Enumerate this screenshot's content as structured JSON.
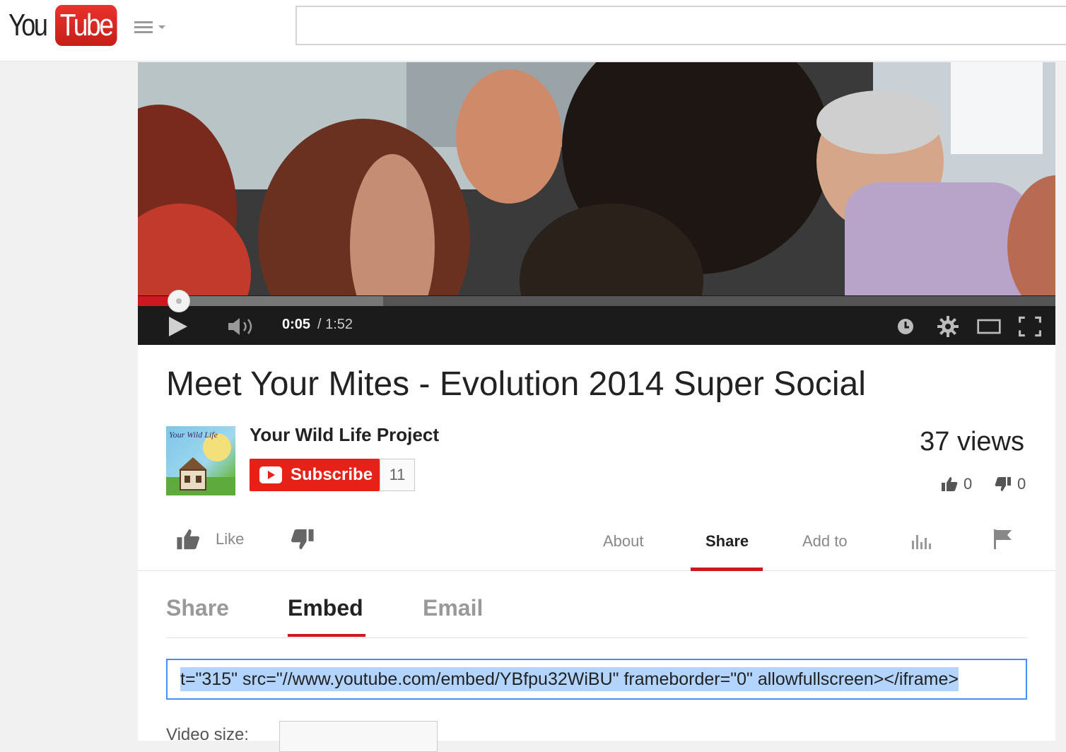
{
  "header": {
    "logo_you": "You",
    "logo_tube": "Tube",
    "search_placeholder": ""
  },
  "player": {
    "current_time": "0:05",
    "separator": " / ",
    "duration": "1:52",
    "progress_played_fraction": 0.045,
    "progress_loaded_fraction": 0.267
  },
  "video": {
    "title": "Meet Your Mites - Evolution 2014 Super Social",
    "channel_name": "Your Wild Life Project",
    "subscribe_label": "Subscribe",
    "subscriber_count": "11",
    "views": "37 views",
    "likes": "0",
    "dislikes": "0",
    "avatar_text": "Your Wild Life"
  },
  "actions": {
    "like_label": "Like",
    "tabs": [
      {
        "label": "About"
      },
      {
        "label": "Share"
      },
      {
        "label": "Add to"
      }
    ],
    "active_tab": "Share"
  },
  "share_panel": {
    "tabs": [
      {
        "label": "Share"
      },
      {
        "label": "Embed"
      },
      {
        "label": "Email"
      }
    ],
    "active_tab": "Embed",
    "embed_code": "t=\"315\" src=\"//www.youtube.com/embed/YBfpu32WiBU\" frameborder=\"0\" allowfullscreen></iframe>",
    "video_size_label": "Video size:"
  },
  "colors": {
    "brand_red": "#cc181e",
    "focus_blue": "#4a8df8",
    "selection": "#b3d4fc"
  }
}
